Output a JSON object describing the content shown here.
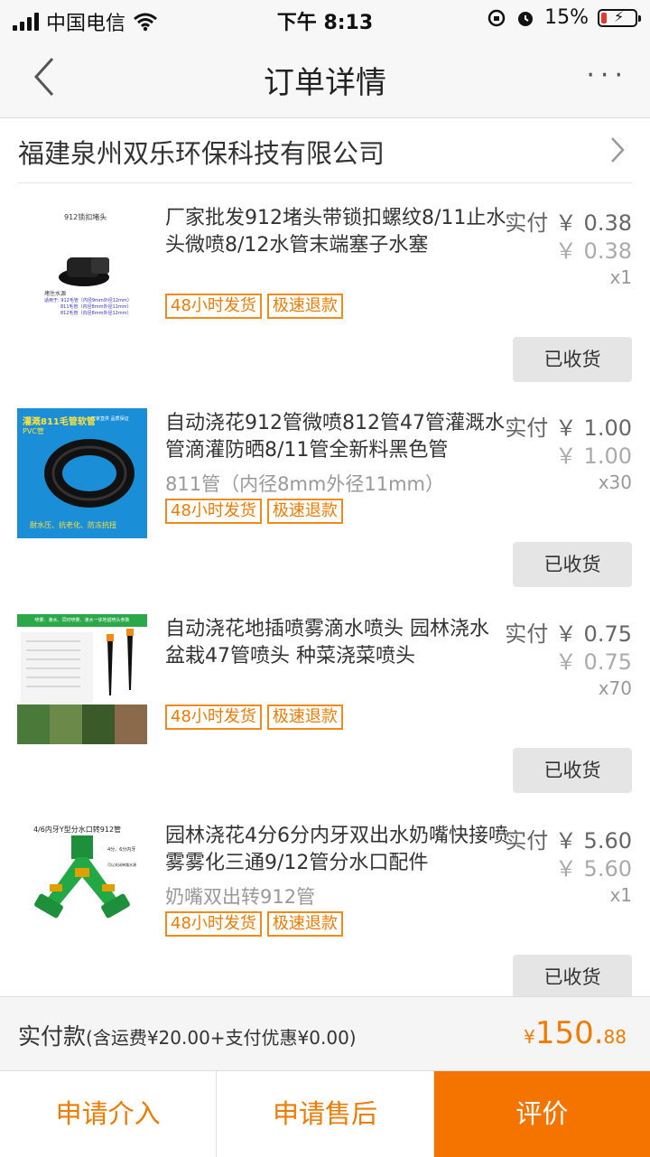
{
  "status": {
    "carrier": "中国电信",
    "time": "下午 8:13",
    "battery": "15%"
  },
  "nav": {
    "title": "订单详情",
    "more": "···"
  },
  "shop": {
    "name": "福建泉州双乐环保科技有限公司"
  },
  "items": [
    {
      "title": "厂家批发912堵头带锁扣螺纹8/11止水头微喷8/12水管末端塞子水塞",
      "spec": "",
      "price": "实付 ￥ 0.38",
      "original_price": "￥ 0.38",
      "qty": "x1",
      "tags": [
        "48小时发货",
        "极速退款"
      ],
      "status_button": "已收货",
      "thumb_text": {
        "t1": "912锁扣堵头",
        "t2": "堵住水源",
        "t3": "适用于: 912毛管（内径9mm外径12mm）",
        "t4": "811毛管（内径8mm外径11mm）",
        "t5": "812毛管（内径8mm外径12mm）"
      }
    },
    {
      "title": "自动浇花912管微喷812管47管灌溉水管滴灌防晒8/11管全新料黑色管",
      "spec": "811管（内径8mm外径11mm）",
      "price": "实付 ￥ 1.00",
      "original_price": "￥ 1.00",
      "qty": "x30",
      "tags": [
        "48小时发货",
        "极速退款"
      ],
      "status_button": "已收货",
      "thumb_text": {
        "t1": "灌溉811毛管软管",
        "t2": "PVC管",
        "t3": "厂家直供 品质保证",
        "t4": "耐水压、抗老化、防冻抗扭"
      }
    },
    {
      "title": "自动浇花地插喷雾滴水喷头 园林浇水盆栽47管喷头 种菜浇菜喷头",
      "spec": "",
      "price": "实付 ￥ 0.75",
      "original_price": "￥ 0.75",
      "qty": "x70",
      "tags": [
        "48小时发货",
        "极速退款"
      ],
      "status_button": "已收货",
      "thumb_text": {
        "t1": "喷雾、滴水、同时喷雾、滴水一体地插喷头参数"
      }
    },
    {
      "title": "园林浇花4分6分内牙双出水奶嘴快接喷雾雾化三通9/12管分水口配件",
      "spec": "奶嘴双出转912管",
      "price": "实付 ￥ 5.60",
      "original_price": "￥ 5.60",
      "qty": "x1",
      "tags": [
        "48小时发货",
        "极速退款"
      ],
      "status_button": "已收货",
      "thumb_text": {
        "t1": "4/6内牙Y型分水口转912管",
        "t2": "4分、6分内牙",
        "t3": "可以关闭单路水源"
      }
    }
  ],
  "total": {
    "label": "实付款",
    "detail": "(含运费¥20.00+支付优惠¥0.00)",
    "currency": "¥",
    "integer": "150.",
    "cents": "88"
  },
  "actions": {
    "intervene": "申请介入",
    "after_sale": "申请售后",
    "review": "评价"
  },
  "colors": {
    "accent": "#f57400",
    "tag_border": "#f08a1a",
    "received_bg": "#e5e5e5"
  }
}
